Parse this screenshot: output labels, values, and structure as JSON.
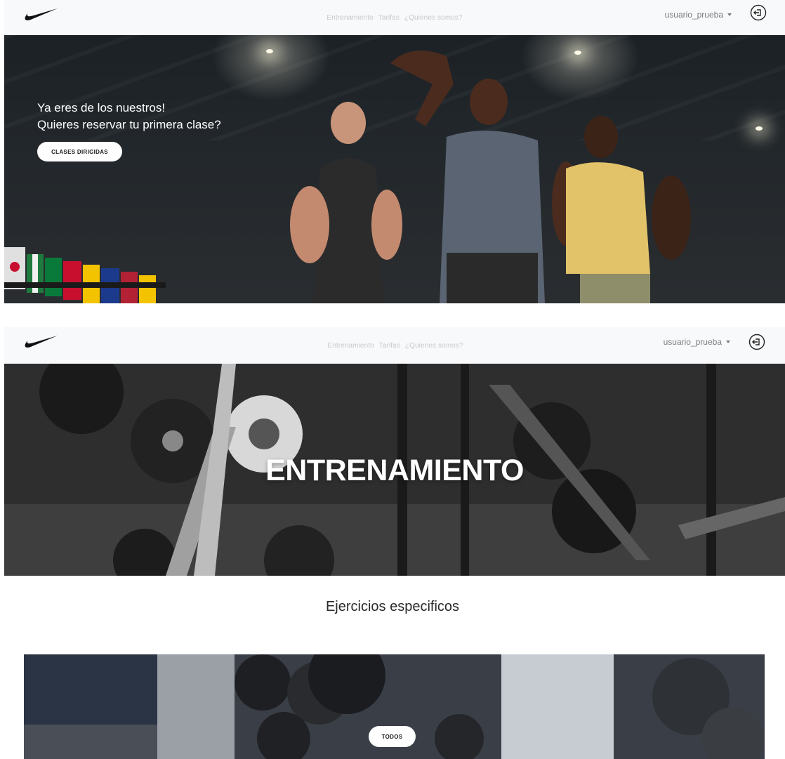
{
  "navbar": {
    "logo_icon": "nike-swoosh-logo",
    "links": [
      "Entrenamiento",
      "Tarifas",
      "¿Quienes somos?"
    ],
    "username": "usuario_prueba",
    "logout_icon": "logout-icon"
  },
  "hero1": {
    "line1": "Ya eres de los nuestros!",
    "line2": "Quieres reservar tu primera clase?",
    "button_label": "CLASES DIRIGIDAS"
  },
  "hero2": {
    "title": "ENTRENAMIENTO"
  },
  "section": {
    "title": "Ejercicios especificos",
    "button_label": "TODOS"
  },
  "colors": {
    "navbar_bg": "#f8f9fa",
    "nav_link": "#c9c9c9",
    "button_bg": "#ffffff",
    "button_text": "#1e1e1e"
  }
}
